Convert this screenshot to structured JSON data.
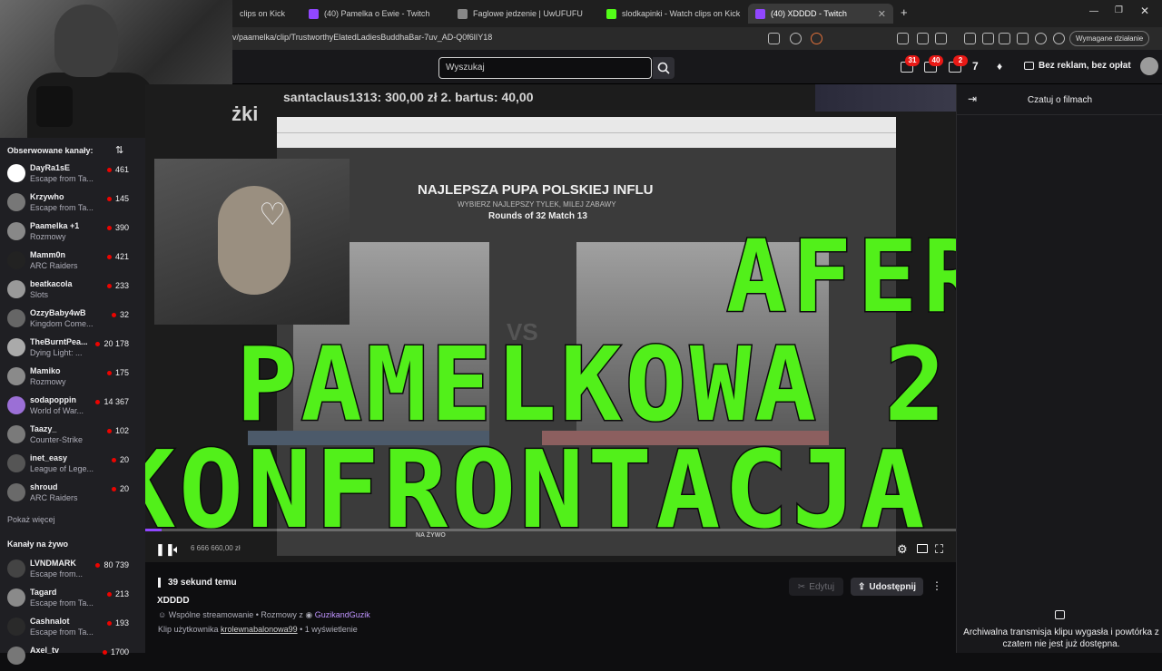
{
  "browser": {
    "tabs": [
      {
        "label": "clips on Kick",
        "color": "#53fc18"
      },
      {
        "label": "(40) Pamelka o Ewie - Twitch",
        "color": "#9147ff"
      },
      {
        "label": "Faglowe jedzenie | UwUFUFU",
        "color": "#888888"
      },
      {
        "label": "slodkapinki - Watch clips on Kick",
        "color": "#53fc18"
      },
      {
        "label": "(40) XDDDD - Twitch",
        "color": "#9147ff"
      }
    ],
    "new_tab": "+",
    "url": "v/paamelka/clip/TrustworthyElatedLadiesBuddhaBar-7uv_AD-Q0f6lIY18",
    "action_required": "Wymagane działanie"
  },
  "twitch_nav": {
    "search_placeholder": "Wyszukaj",
    "badges": [
      "31",
      "40",
      "2"
    ],
    "adfree_label": "Bez reklam, bez opłat"
  },
  "sidebar": {
    "followed_heading": "Obserwowane kanały:",
    "followed": [
      {
        "name": "DayRa1sE",
        "game": "Escape from Ta...",
        "viewers": "461",
        "color": "#ffffff"
      },
      {
        "name": "Krzywho",
        "game": "Escape from Ta...",
        "viewers": "145",
        "color": "#777777"
      },
      {
        "name": "Paamelka +1",
        "game": "Rozmowy",
        "viewers": "390",
        "color": "#888888"
      },
      {
        "name": "Mamm0n",
        "game": "ARC Raiders",
        "viewers": "421",
        "color": "#222222"
      },
      {
        "name": "beatkacola",
        "game": "Slots",
        "viewers": "233",
        "color": "#999999"
      },
      {
        "name": "OzzyBaby4wB",
        "game": "Kingdom Come...",
        "viewers": "32",
        "color": "#666666"
      },
      {
        "name": "TheBurntPea...",
        "game": "Dying Light: ...",
        "viewers": "20 178",
        "color": "#aaaaaa"
      },
      {
        "name": "Mamiko",
        "game": "Rozmowy",
        "viewers": "175",
        "color": "#8a8a8a"
      },
      {
        "name": "sodapoppin",
        "game": "World of War...",
        "viewers": "14 367",
        "color": "#9b6fd6"
      },
      {
        "name": "Taazy_",
        "game": "Counter-Strike",
        "viewers": "102",
        "color": "#7a7a7a"
      },
      {
        "name": "inet_easy",
        "game": "League of Lege...",
        "viewers": "20",
        "color": "#555555"
      },
      {
        "name": "shroud",
        "game": "ARC Raiders",
        "viewers": "20",
        "color": "#6a6a6a"
      }
    ],
    "show_more": "Pokaż więcej",
    "live_heading": "Kanały na żywo",
    "live": [
      {
        "name": "LVNDMARK",
        "game": "Escape from...",
        "viewers": "80 739",
        "color": "#444444"
      },
      {
        "name": "Tagard",
        "game": "Escape from Ta...",
        "viewers": "213",
        "color": "#8a8a8a"
      },
      {
        "name": "Cashnalot",
        "game": "Escape from Ta...",
        "viewers": "193",
        "color": "#2a2a2a"
      },
      {
        "name": "Axel_tv",
        "game": "",
        "viewers": "1700",
        "color": "#777777"
      }
    ]
  },
  "video": {
    "donation_ticker": "santaclaus1313: 300,00 zł 2. bartus: 40,00",
    "partial_word": "żki",
    "inner_title": "NAJLEPSZA PUPA POLSKIEJ INFLU",
    "inner_subtitle": "WYBIERZ NAJLEPSZY TYLEK, MILEJ ZABAWY",
    "inner_round": "Rounds of 32 Match 13",
    "vs": "VS",
    "overlay_line1": "AFERA",
    "overlay_line2": "PAMELKOWA 2",
    "overlay_line3": "KONFRONTACJA",
    "counter": "6 666 660,00 zł",
    "na_zywo": "NA ŻYWO",
    "progress": 0.02
  },
  "clip_info": {
    "time_ago": "39 sekund temu",
    "title": "XDDDD",
    "collab_prefix": "Wspólne streamowanie • Rozmowy z",
    "collab_partner": "GuzikandGuzik",
    "clipped_by_prefix": "Klip użytkownika",
    "clipped_by_user": "krolewnabalonowa99",
    "views": "1 wyświetlenie",
    "edit_label": "Edytuj",
    "share_label": "Udostępnij"
  },
  "chat": {
    "title": "Czatuj o filmach",
    "archive_msg": "Archiwalna transmisja klipu wygasła i powtórka z czatem nie jest już dostępna."
  }
}
